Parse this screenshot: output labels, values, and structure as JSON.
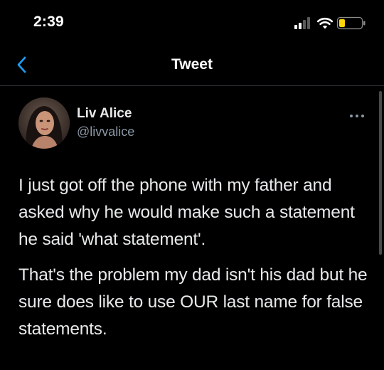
{
  "status_bar": {
    "time": "2:39",
    "icons": [
      "signal-icon",
      "wifi-icon",
      "battery-icon"
    ]
  },
  "nav": {
    "back_icon": "chevron-left-icon",
    "title": "Tweet"
  },
  "author": {
    "name": "Liv Alice",
    "handle": "@livvalice",
    "more_icon": "ellipsis-icon"
  },
  "tweet": {
    "paragraphs": [
      "I just got off the phone with my father and asked why he would make such a statement he said 'what statement'.",
      "That's the problem my dad isn't his dad but he sure does like to use OUR last name for false statements."
    ]
  },
  "colors": {
    "background": "#000000",
    "text": "#e7e9ea",
    "secondary_text": "#8b98a5",
    "accent": "#1d9bf0",
    "divider": "#2f3336"
  }
}
